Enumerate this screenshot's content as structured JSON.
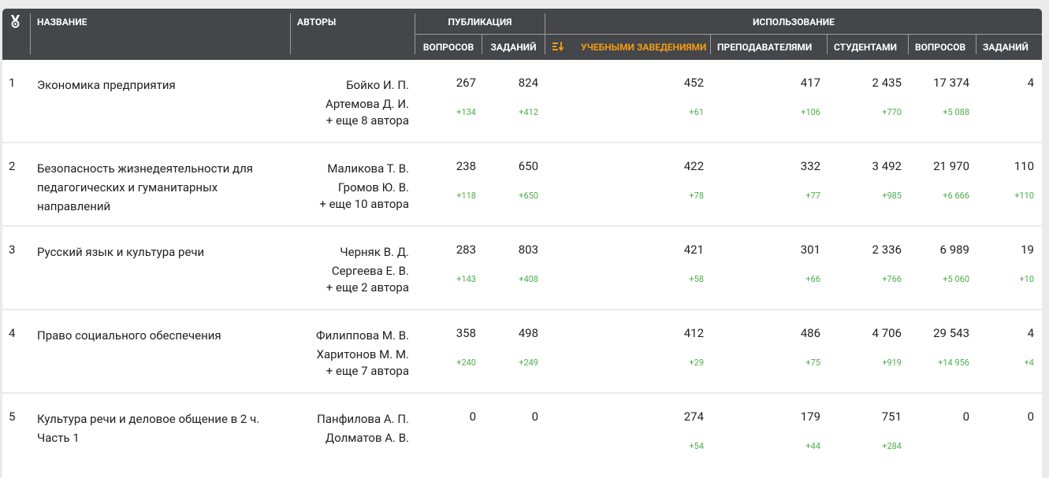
{
  "header": {
    "col_name": "НАЗВАНИЕ",
    "col_authors": "АВТОРЫ",
    "group_publication": "ПУБЛИКАЦИЯ",
    "group_usage": "ИСПОЛЬЗОВАНИЕ",
    "pub_questions": "ВОПРОСОВ",
    "pub_tasks": "ЗАДАНИЙ",
    "use_institutions": "УЧЕБНЫМИ ЗАВЕДЕНИЯМИ",
    "use_teachers": "ПРЕПОДАВАТЕЛЯМИ",
    "use_students": "СТУДЕНТАМИ",
    "use_questions": "ВОПРОСОВ",
    "use_tasks": "ЗАДАНИЙ",
    "sort_icon": "sort-desc-icon",
    "rank_icon": "award-icon"
  },
  "rows": [
    {
      "rank": "1",
      "title_lines": [
        "Экономика предприятия"
      ],
      "authors": [
        "Бойко И. П.",
        "Артемова Д. И."
      ],
      "more": "+ еще 8 автора",
      "pub_q": "267",
      "pub_q_d": "+134",
      "pub_t": "824",
      "pub_t_d": "+412",
      "inst": "452",
      "inst_d": "+61",
      "teach": "417",
      "teach_d": "+106",
      "stud": "2 435",
      "stud_d": "+770",
      "uq": "17 374",
      "uq_d": "+5 088",
      "ut": "4",
      "ut_d": ""
    },
    {
      "rank": "2",
      "title_lines": [
        "Безопасность жизнедеятельности для",
        "педагогических и гуманитарных",
        "направлений"
      ],
      "authors": [
        "Маликова Т. В.",
        "Громов Ю. В."
      ],
      "more": "+ еще 10 автора",
      "pub_q": "238",
      "pub_q_d": "+118",
      "pub_t": "650",
      "pub_t_d": "+650",
      "inst": "422",
      "inst_d": "+78",
      "teach": "332",
      "teach_d": "+77",
      "stud": "3 492",
      "stud_d": "+985",
      "uq": "21 970",
      "uq_d": "+6 666",
      "ut": "110",
      "ut_d": "+110"
    },
    {
      "rank": "3",
      "title_lines": [
        "Русский язык и культура речи"
      ],
      "authors": [
        "Черняк В. Д.",
        "Сергеева Е. В."
      ],
      "more": "+ еще 2 автора",
      "pub_q": "283",
      "pub_q_d": "+143",
      "pub_t": "803",
      "pub_t_d": "+408",
      "inst": "421",
      "inst_d": "+58",
      "teach": "301",
      "teach_d": "+66",
      "stud": "2 336",
      "stud_d": "+766",
      "uq": "6 989",
      "uq_d": "+5 060",
      "ut": "19",
      "ut_d": "+10"
    },
    {
      "rank": "4",
      "title_lines": [
        "Право социального обеспечения"
      ],
      "authors": [
        "Филиппова М. В.",
        "Харитонов М. М."
      ],
      "more": "+ еще 7 автора",
      "pub_q": "358",
      "pub_q_d": "+240",
      "pub_t": "498",
      "pub_t_d": "+249",
      "inst": "412",
      "inst_d": "+29",
      "teach": "486",
      "teach_d": "+75",
      "stud": "4 706",
      "stud_d": "+919",
      "uq": "29 543",
      "uq_d": "+14 956",
      "ut": "4",
      "ut_d": "+4"
    },
    {
      "rank": "5",
      "title_lines": [
        "Культура речи и деловое общение в 2 ч.",
        "Часть 1"
      ],
      "authors": [
        "Панфилова А. П.",
        "Долматов А. В."
      ],
      "more": "",
      "pub_q": "0",
      "pub_q_d": "",
      "pub_t": "0",
      "pub_t_d": "",
      "inst": "274",
      "inst_d": "+54",
      "teach": "179",
      "teach_d": "+44",
      "stud": "751",
      "stud_d": "+284",
      "uq": "0",
      "uq_d": "",
      "ut": "0",
      "ut_d": ""
    }
  ]
}
